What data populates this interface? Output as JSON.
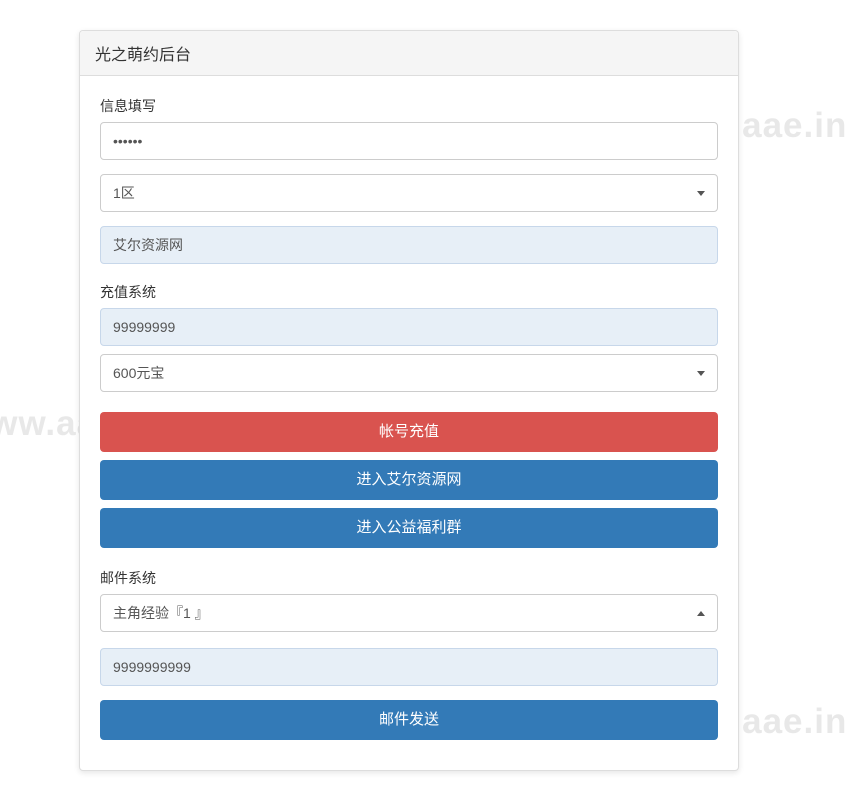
{
  "watermark": "www.aae.ink",
  "panel": {
    "title": "光之萌约后台"
  },
  "info": {
    "label": "信息填写",
    "password_value": "••••••",
    "zone_value": "1区",
    "site_name": "艾尔资源网"
  },
  "recharge": {
    "label": "充值系统",
    "amount_value": "99999999",
    "item_value": "600元宝",
    "btn_recharge": "帐号充值",
    "btn_site": "进入艾尔资源网",
    "btn_group": "进入公益福利群"
  },
  "mail": {
    "label": "邮件系统",
    "template_value": "主角经验『1 』",
    "quantity_value": "9999999999",
    "btn_send": "邮件发送"
  }
}
